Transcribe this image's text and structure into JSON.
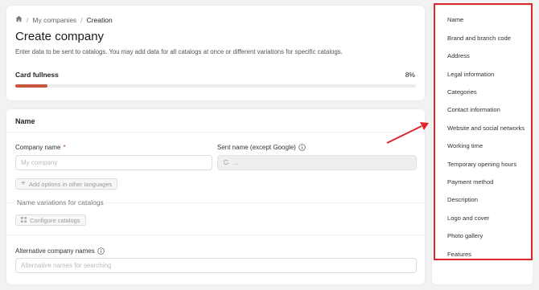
{
  "breadcrumb": {
    "home_icon": "home-icon",
    "items": [
      "My companies",
      "Creation"
    ],
    "separator": "/"
  },
  "page": {
    "title": "Create company",
    "subtitle": "Enter data to be sent to catalogs. You may add data for all catalogs at once or different variations for specific catalogs."
  },
  "fullness": {
    "label": "Card fullness",
    "value_text": "8%",
    "value": 0.08,
    "bar_color": "#c9563c"
  },
  "name_section": {
    "title": "Name",
    "company_name_label": "Company name",
    "required_mark": "*",
    "company_name_placeholder": "My company",
    "sent_name_label": "Sent name (except Google)",
    "sent_name_value": "...",
    "add_languages_button": "Add options in other languages",
    "variations_label": "Name variations for catalogs",
    "configure_catalogs_button": "Configure catalogs",
    "alt_names_label": "Alternative company names",
    "alt_names_placeholder": "Alternative names for searching"
  },
  "nav": {
    "items": [
      "Name",
      "Brand and branch code",
      "Address",
      "Legal information",
      "Categories",
      "Contact information",
      "Website and social networks",
      "Working time",
      "Temporary opening hours",
      "Payment method",
      "Description",
      "Logo and cover",
      "Photo gallery",
      "Features"
    ]
  },
  "annotation": {
    "color": "#e0262b"
  }
}
